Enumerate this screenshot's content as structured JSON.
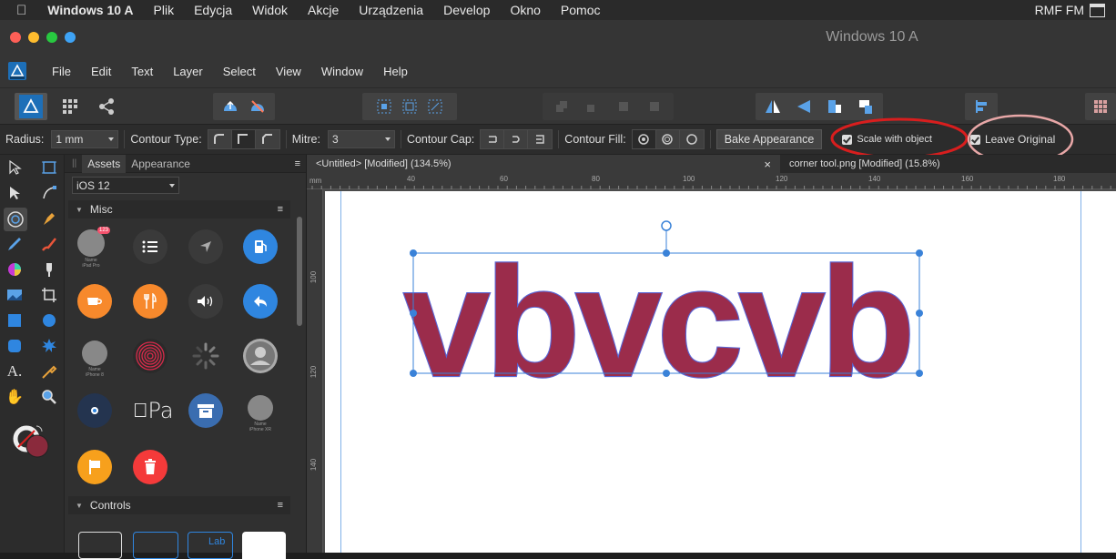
{
  "macmenu": {
    "app_name": "Windows 10 A",
    "items": [
      "Plik",
      "Edycja",
      "Widok",
      "Akcje",
      "Urządzenia",
      "Develop",
      "Okno",
      "Pomoc"
    ],
    "right_label": "RMF FM"
  },
  "window": {
    "title": "Windows 10 A"
  },
  "appmenu": {
    "items": [
      "File",
      "Edit",
      "Text",
      "Layer",
      "Select",
      "View",
      "Window",
      "Help"
    ]
  },
  "context": {
    "radius_label": "Radius:",
    "radius_value": "1 mm",
    "contour_type_label": "Contour Type:",
    "mitre_label": "Mitre:",
    "mitre_value": "3",
    "contour_cap_label": "Contour Cap:",
    "contour_fill_label": "Contour Fill:",
    "bake_button": "Bake Appearance",
    "scale_with_object": "Scale with object",
    "leave_original": "Leave Original"
  },
  "panel": {
    "tab_assets": "Assets",
    "tab_appearance": "Appearance",
    "set_dropdown": "iOS 12",
    "section_misc": "Misc",
    "section_controls": "Controls",
    "badge_count": "123",
    "label_name_ipad": "Name\niPad Pro",
    "label_name_iphone8": "Name\niPhone 8",
    "label_name_iphonexr": "Name\niPhone XR",
    "applepay_text": "Pa",
    "controls_label": "Lab"
  },
  "doctabs": {
    "tab1": "<Untitled> [Modified] (134.5%)",
    "tab2": "corner tool.png [Modified] (15.8%)",
    "close": "×"
  },
  "ruler": {
    "unit": "mm",
    "h_ticks": [
      "40",
      "60",
      "80",
      "100",
      "120",
      "140",
      "160",
      "180"
    ],
    "v_ticks": [
      "100",
      "120",
      "140"
    ]
  },
  "canvas": {
    "text": "vbvcvb"
  },
  "colors": {
    "accent": "#1d6fb8",
    "text_fill": "#9b2c4b",
    "text_stroke": "#5a66d6",
    "annotation_red": "#d81e1e",
    "annotation_pink": "#e8a7a7"
  }
}
